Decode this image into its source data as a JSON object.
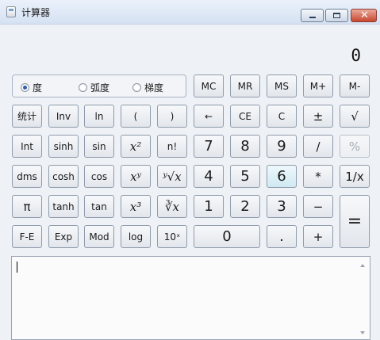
{
  "window": {
    "title": "计算器",
    "close_glyph": "✕"
  },
  "display": {
    "value": "0"
  },
  "angle": {
    "options": [
      {
        "label": "度",
        "selected": true
      },
      {
        "label": "弧度",
        "selected": false
      },
      {
        "label": "梯度",
        "selected": false
      }
    ]
  },
  "buttons": {
    "mc": "MC",
    "mr": "MR",
    "ms": "MS",
    "mplus": "M+",
    "mminus": "M-",
    "stats": "统计",
    "inv": "Inv",
    "ln": "ln",
    "lparen": "(",
    "rparen": ")",
    "backspace": "←",
    "ce": "CE",
    "c": "C",
    "plusminus": "±",
    "sqrt": "√",
    "int": "Int",
    "sinh": "sinh",
    "sin": "sin",
    "x2": "x²",
    "fact": "n!",
    "n7": "7",
    "n8": "8",
    "n9": "9",
    "div": "/",
    "pct": "%",
    "dms": "dms",
    "cosh": "cosh",
    "cos": "cos",
    "xy": "xʸ",
    "yroot": "ʸ√x",
    "n4": "4",
    "n5": "5",
    "n6": "6",
    "mul": "*",
    "recip": "1/x",
    "pi": "π",
    "tanh": "tanh",
    "tan": "tan",
    "x3": "x³",
    "cuberoot": "∛x",
    "n1": "1",
    "n2": "2",
    "n3": "3",
    "sub": "−",
    "eq": "=",
    "fe": "F-E",
    "exp": "Exp",
    "mod": "Mod",
    "log": "log",
    "tenx": "10ˣ",
    "n0": "0",
    "dot": ".",
    "add": "+"
  },
  "icons": {
    "app": "calculator-icon",
    "min": "minimize-icon",
    "max": "maximize-icon",
    "close": "close-icon",
    "scroll_up": "scroll-up-arrow-icon",
    "scroll_down": "scroll-down-arrow-icon"
  }
}
